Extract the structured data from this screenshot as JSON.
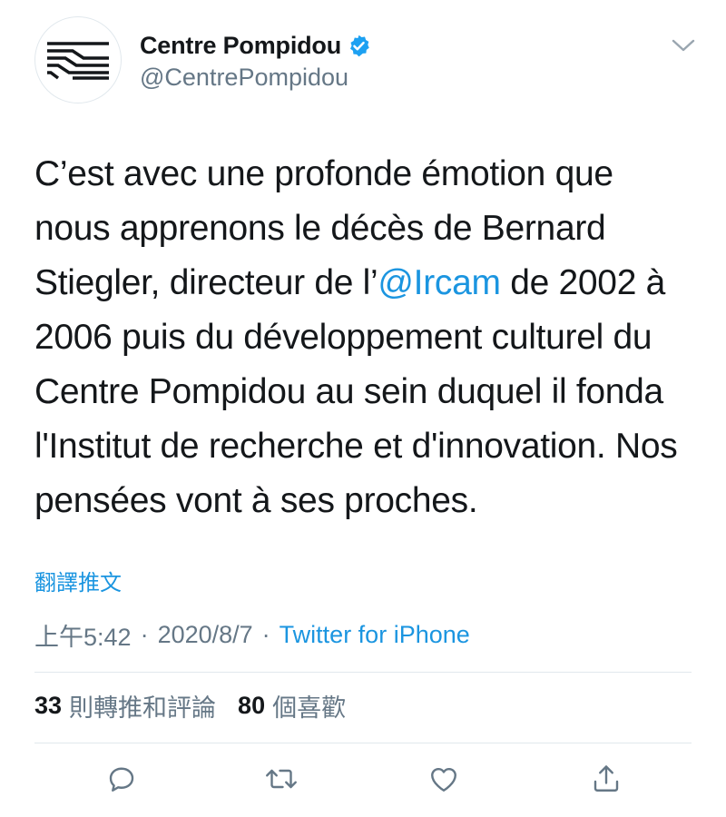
{
  "account": {
    "display_name": "Centre Pompidou",
    "handle": "@CentrePompidou",
    "verified": true,
    "avatar_icon": "centre-pompidou-logo-icon"
  },
  "tweet": {
    "text_before_mention": "C’est avec une profonde émotion que nous apprenons le décès de Bernard Stiegler, directeur de l’",
    "mention": "@Ircam",
    "text_after_mention": " de 2002 à 2006 puis du développement culturel du Centre Pompidou au sein duquel il fonda l'Institut de recherche et d'innovation. Nos pensées vont à ses proches."
  },
  "translate_label": "翻譯推文",
  "meta": {
    "time": "上午5:42",
    "date": "2020/8/7",
    "separator": "·",
    "source": "Twitter for iPhone"
  },
  "stats": {
    "retweets_count": "33",
    "retweets_label": "則轉推和評論",
    "likes_count": "80",
    "likes_label": "個喜歡"
  },
  "actions": [
    "reply-icon",
    "retweet-icon",
    "like-icon",
    "share-icon"
  ],
  "colors": {
    "accent": "#1b95e0",
    "secondary_text": "#657786",
    "primary_text": "#14171a",
    "divider": "#e1e8ed"
  }
}
